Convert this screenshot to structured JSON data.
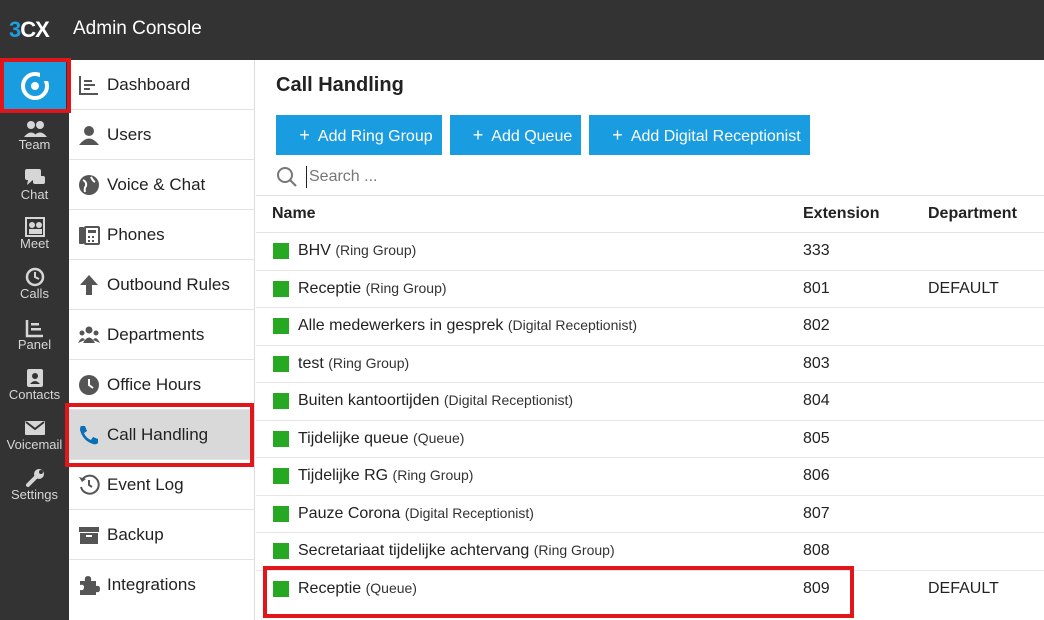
{
  "topbar": {
    "logo": "3CX",
    "title": "Admin Console"
  },
  "rail": [
    {
      "label": "Team",
      "icon": "team-icon"
    },
    {
      "label": "Chat",
      "icon": "chat-icon"
    },
    {
      "label": "Meet",
      "icon": "meet-icon"
    },
    {
      "label": "Calls",
      "icon": "calls-history-icon"
    },
    {
      "label": "Panel",
      "icon": "panel-icon"
    },
    {
      "label": "Contacts",
      "icon": "contacts-icon"
    },
    {
      "label": "Voicemail",
      "icon": "voicemail-icon"
    },
    {
      "label": "Settings",
      "icon": "settings-icon"
    }
  ],
  "nav": [
    {
      "label": "Dashboard",
      "icon": "dashboard-icon"
    },
    {
      "label": "Users",
      "icon": "user-icon"
    },
    {
      "label": "Voice & Chat",
      "icon": "globe-icon"
    },
    {
      "label": "Phones",
      "icon": "phone-device-icon"
    },
    {
      "label": "Outbound Rules",
      "icon": "arrow-up-icon"
    },
    {
      "label": "Departments",
      "icon": "departments-icon"
    },
    {
      "label": "Office Hours",
      "icon": "clock-icon"
    },
    {
      "label": "Call Handling",
      "icon": "phone-handset-icon",
      "active": true
    },
    {
      "label": "Event Log",
      "icon": "history-icon"
    },
    {
      "label": "Backup",
      "icon": "archive-icon"
    },
    {
      "label": "Integrations",
      "icon": "puzzle-icon"
    }
  ],
  "main": {
    "title": "Call Handling",
    "buttons": [
      "Add Ring Group",
      "Add Queue",
      "Add Digital Receptionist"
    ],
    "search_placeholder": "Search ..."
  },
  "table": {
    "columns": [
      "Name",
      "Extension",
      "Department"
    ],
    "rows": [
      {
        "name": "BHV",
        "type": "(Ring Group)",
        "extension": "333",
        "department": ""
      },
      {
        "name": "Receptie",
        "type": "(Ring Group)",
        "extension": "801",
        "department": "DEFAULT"
      },
      {
        "name": "Alle medewerkers in gesprek",
        "type": "(Digital Receptionist)",
        "extension": "802",
        "department": ""
      },
      {
        "name": "test",
        "type": "(Ring Group)",
        "extension": "803",
        "department": ""
      },
      {
        "name": "Buiten kantoortijden",
        "type": "(Digital Receptionist)",
        "extension": "804",
        "department": ""
      },
      {
        "name": "Tijdelijke queue",
        "type": "(Queue)",
        "extension": "805",
        "department": ""
      },
      {
        "name": "Tijdelijke RG",
        "type": "(Ring Group)",
        "extension": "806",
        "department": ""
      },
      {
        "name": "Pauze Corona",
        "type": "(Digital Receptionist)",
        "extension": "807",
        "department": ""
      },
      {
        "name": "Secretariaat tijdelijke achtervang",
        "type": "(Ring Group)",
        "extension": "808",
        "department": ""
      },
      {
        "name": "Receptie",
        "type": "(Queue)",
        "extension": "809",
        "department": "DEFAULT"
      }
    ]
  },
  "colors": {
    "accent": "#1a9de0",
    "topbar": "#333333",
    "status": "#27a822",
    "highlight": "#e0161b"
  }
}
